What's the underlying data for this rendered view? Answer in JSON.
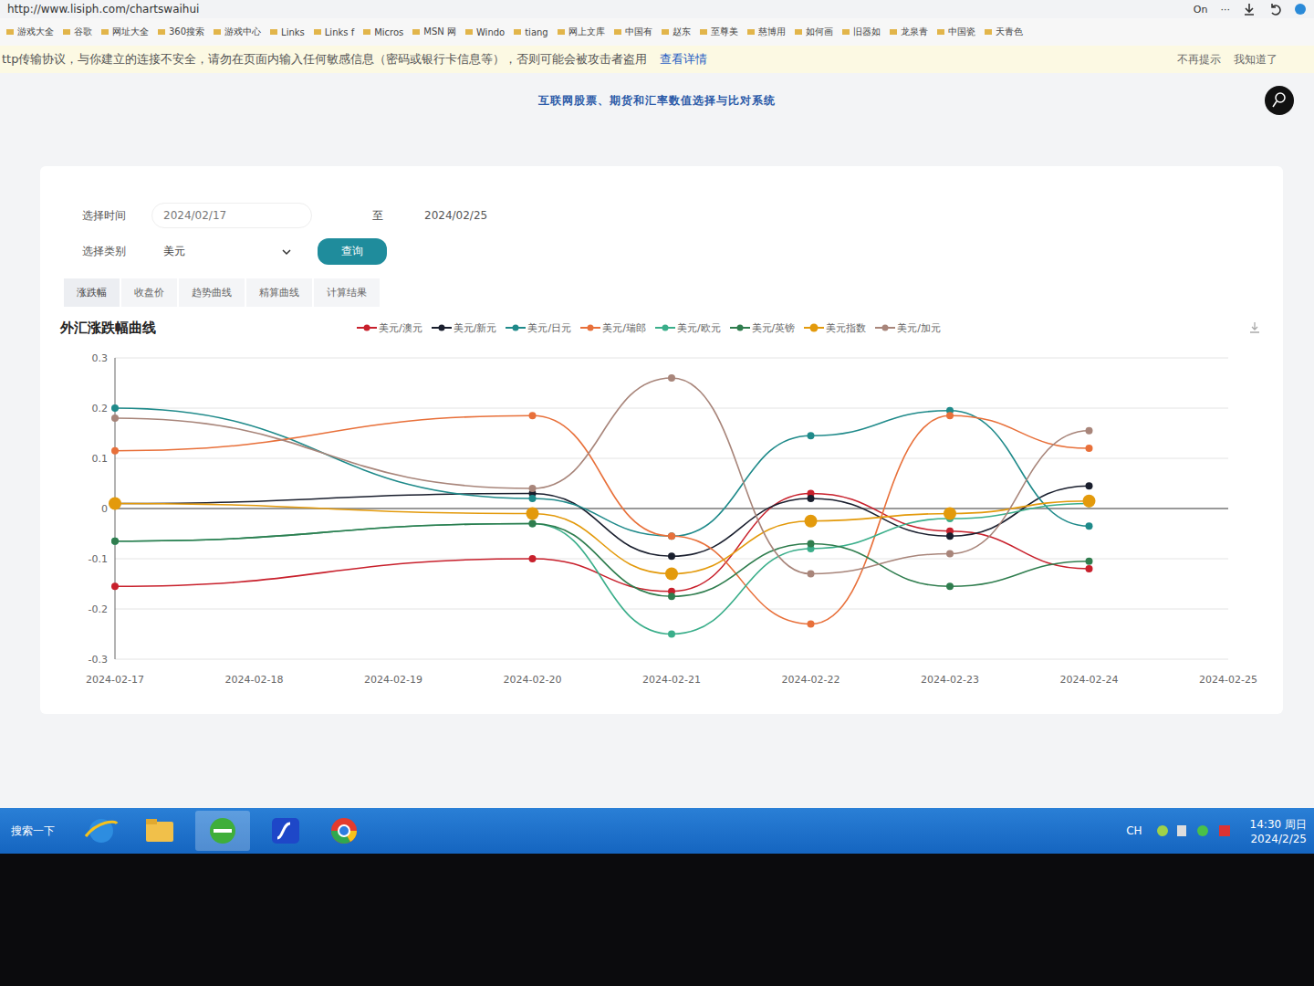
{
  "browser": {
    "url": "http://www.lisiph.com/chartswaihui",
    "extension_label": "On",
    "more": "···"
  },
  "bookmarks": [
    "游戏大全",
    "谷歌",
    "网址大全",
    "360搜索",
    "游戏中心",
    "Links",
    "Links f",
    "Micros",
    "MSN 网",
    "Windo",
    "tiang",
    "网上文库",
    "中国有",
    "赵东",
    "至尊美",
    "慈博用",
    "如何画",
    "旧器如",
    "龙泉青",
    "中国瓷",
    "天青色"
  ],
  "warning": {
    "text": "ttp传输协议，与你建立的连接不安全，请勿在页面内输入任何敏感信息（密码或银行卡信息等），否则可能会被攻击者盗用",
    "link": "查看详情",
    "actions": [
      "不再提示",
      "我知道了"
    ]
  },
  "page": {
    "title": "互联网股票、期货和汇率数值选择与比对系统"
  },
  "form": {
    "time_label": "选择时间",
    "start": "2024/02/17",
    "to": "至",
    "end": "2024/02/25",
    "category_label": "选择类别",
    "category": "美元",
    "query": "查询"
  },
  "tabs": [
    {
      "label": "涨跌幅",
      "selected": true
    },
    {
      "label": "收盘价",
      "selected": false
    },
    {
      "label": "趋势曲线",
      "selected": false
    },
    {
      "label": "精算曲线",
      "selected": false
    },
    {
      "label": "计算结果",
      "selected": false
    }
  ],
  "chart": {
    "title": "外汇涨跌幅曲线",
    "y_ticks": [
      "0.3",
      "0.2",
      "0.1",
      "0",
      "-0.1",
      "-0.2",
      "-0.3"
    ],
    "x_labels": [
      "2024-02-17",
      "2024-02-18",
      "2024-02-19",
      "2024-02-20",
      "2024-02-21",
      "2024-02-22",
      "2024-02-23",
      "2024-02-24",
      "2024-02-25"
    ],
    "series": [
      {
        "name": "美元/澳元",
        "color": "#c8202c",
        "highlighted": false,
        "values": [
          -0.155,
          null,
          null,
          -0.1,
          -0.165,
          0.03,
          -0.045,
          -0.12,
          null
        ]
      },
      {
        "name": "美元/新元",
        "color": "#1a1f2e",
        "highlighted": false,
        "values": [
          0.01,
          null,
          null,
          0.03,
          -0.095,
          0.02,
          -0.055,
          0.045,
          null
        ]
      },
      {
        "name": "美元/日元",
        "color": "#1f8a8a",
        "highlighted": false,
        "values": [
          0.2,
          null,
          null,
          0.02,
          -0.055,
          0.145,
          0.195,
          -0.035,
          null
        ]
      },
      {
        "name": "美元/瑞郎",
        "color": "#e8703a",
        "highlighted": false,
        "values": [
          0.115,
          null,
          null,
          0.185,
          -0.055,
          -0.23,
          0.185,
          0.12,
          null
        ]
      },
      {
        "name": "美元/欧元",
        "color": "#3aae8a",
        "highlighted": false,
        "values": [
          -0.065,
          null,
          null,
          -0.03,
          -0.25,
          -0.08,
          -0.02,
          0.01,
          null
        ]
      },
      {
        "name": "美元/英镑",
        "color": "#2f7d4e",
        "highlighted": false,
        "values": [
          -0.065,
          null,
          null,
          -0.03,
          -0.175,
          -0.07,
          -0.155,
          -0.105,
          null
        ]
      },
      {
        "name": "美元指数",
        "color": "#e39a0c",
        "highlighted": true,
        "values": [
          0.01,
          null,
          null,
          -0.01,
          -0.13,
          -0.025,
          -0.01,
          0.015,
          null
        ]
      },
      {
        "name": "美元/加元",
        "color": "#a8857a",
        "highlighted": false,
        "values": [
          0.18,
          null,
          null,
          0.04,
          0.26,
          -0.13,
          -0.09,
          0.155,
          null
        ]
      }
    ]
  },
  "taskbar": {
    "search": "搜索一下",
    "lang": "CH",
    "time": "14:30 周日",
    "date": "2024/2/25"
  }
}
